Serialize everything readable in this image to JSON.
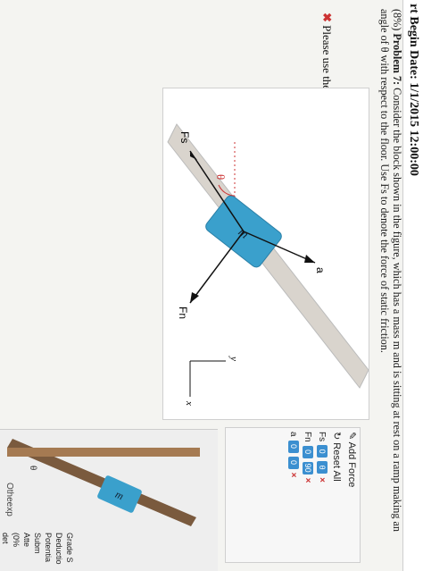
{
  "header": {
    "text": "rt Begin Date: 1/1/2015 12:00:00"
  },
  "problem": {
    "points": "(8%)",
    "label": "Problem 7:",
    "text": "Consider the block shown in the figure, which has a mass m and is sitting at rest on a ramp making an angle of θ with respect to the floor. Use Fs to denote the force of static friction."
  },
  "prompt": {
    "marker": "✖",
    "text": "Please use the interactive area below to draw the Free Body Diagram for the block."
  },
  "diagram": {
    "block_label": "m",
    "angle_label": "θ",
    "force_fn": "Fn",
    "force_fs": "Fs",
    "force_a": "a",
    "axis_x": "x",
    "axis_y": "y"
  },
  "toolbar": {
    "add_force": "Add Force",
    "reset_all": "Reset All",
    "rows": [
      {
        "name": "Fs",
        "v1": "0",
        "v2": "θ"
      },
      {
        "name": "Fn",
        "v1": "0",
        "v2": "90"
      },
      {
        "name": "a",
        "v1": "0",
        "v2": "0"
      }
    ],
    "remove": "×"
  },
  "photo": {
    "block_label": "m",
    "angle_label": "θ"
  },
  "sidebar": {
    "lines": [
      "Grade S",
      "Deductio",
      "Potentia",
      "",
      "Subm",
      "Atte",
      "(0%",
      "det",
      "1"
    ]
  },
  "footer": {
    "text": "Otheexp"
  }
}
